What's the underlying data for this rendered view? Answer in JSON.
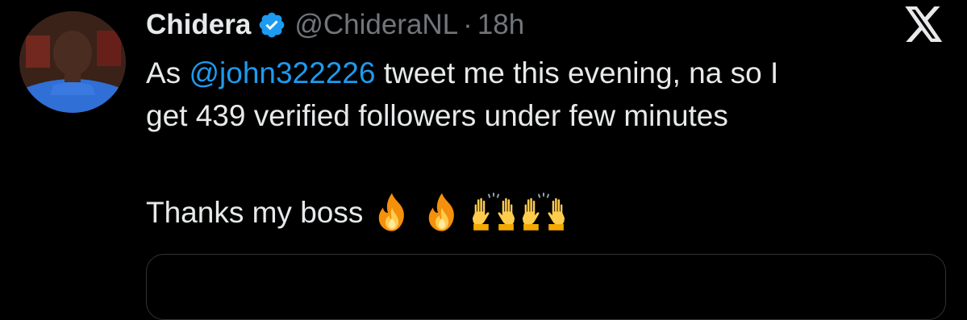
{
  "tweet": {
    "author": {
      "display_name": "Chidera",
      "handle": "@ChideraNL",
      "verified": true
    },
    "separator": "·",
    "timestamp": "18h",
    "text": {
      "line1_prefix": "As ",
      "mention": "@john322226",
      "line1_suffix": " tweet me this evening, na so I",
      "line2": "get 439 verified followers under few minutes",
      "line3": "Thanks my boss"
    },
    "emojis": [
      "fire-emoji",
      "fire-emoji",
      "raising-hands-emoji",
      "raising-hands-emoji"
    ]
  },
  "colors": {
    "background": "#000000",
    "text": "#e7e9ea",
    "secondary_text": "#71767b",
    "accent": "#1d9bf0",
    "border": "#2f3336"
  }
}
